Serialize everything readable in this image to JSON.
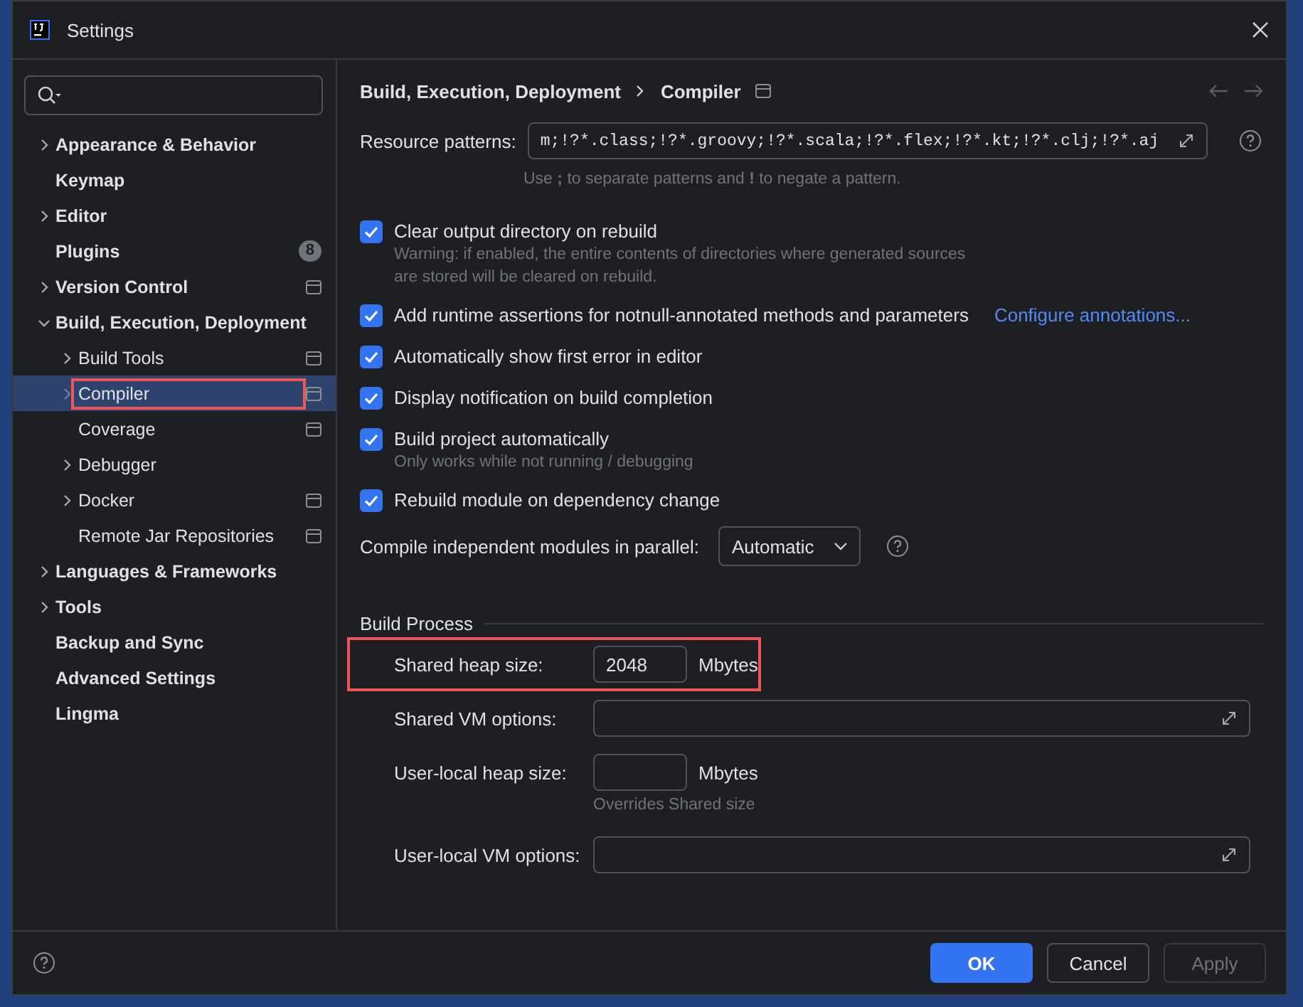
{
  "window": {
    "title": "Settings"
  },
  "sidebar": {
    "items": [
      {
        "label": "Appearance & Behavior",
        "has_children": true,
        "expanded": false,
        "selected": false
      },
      {
        "label": "Keymap",
        "has_children": false,
        "selected": false
      },
      {
        "label": "Editor",
        "has_children": true,
        "expanded": false,
        "selected": false
      },
      {
        "label": "Plugins",
        "has_children": false,
        "selected": false,
        "badge": "8"
      },
      {
        "label": "Version Control",
        "has_children": true,
        "expanded": false,
        "selected": false,
        "project_scope": true
      },
      {
        "label": "Build, Execution, Deployment",
        "has_children": true,
        "expanded": true,
        "selected": false,
        "children": [
          {
            "label": "Build Tools",
            "has_children": true,
            "expanded": false,
            "selected": false,
            "project_scope": true
          },
          {
            "label": "Compiler",
            "has_children": true,
            "expanded": false,
            "selected": true,
            "highlighted": true,
            "project_scope": true
          },
          {
            "label": "Coverage",
            "has_children": false,
            "selected": false,
            "project_scope": true
          },
          {
            "label": "Debugger",
            "has_children": true,
            "expanded": false,
            "selected": false
          },
          {
            "label": "Docker",
            "has_children": true,
            "expanded": false,
            "selected": false,
            "project_scope": true
          },
          {
            "label": "Remote Jar Repositories",
            "has_children": false,
            "selected": false,
            "project_scope": true
          }
        ]
      },
      {
        "label": "Languages & Frameworks",
        "has_children": true,
        "expanded": false,
        "selected": false
      },
      {
        "label": "Tools",
        "has_children": true,
        "expanded": false,
        "selected": false
      },
      {
        "label": "Backup and Sync",
        "has_children": false,
        "selected": false
      },
      {
        "label": "Advanced Settings",
        "has_children": false,
        "selected": false
      },
      {
        "label": "Lingma",
        "has_children": false,
        "selected": false
      }
    ]
  },
  "breadcrumb": [
    "Build, Execution, Deployment",
    "Compiler"
  ],
  "resource_patterns": {
    "label": "Resource patterns:",
    "value": "m;!?*.class;!?*.groovy;!?*.scala;!?*.flex;!?*.kt;!?*.clj;!?*.aj",
    "hint": "Use **;** to separate patterns and **!** to negate a pattern."
  },
  "options": [
    {
      "label": "Clear output directory on rebuild",
      "checked": true,
      "note": "Warning: if enabled, the entire contents of directories where generated sources are stored will be cleared on rebuild."
    },
    {
      "label": "Add runtime assertions for notnull-annotated methods and parameters",
      "checked": true,
      "link": "Configure annotations..."
    },
    {
      "label": "Automatically show first error in editor",
      "checked": true
    },
    {
      "label": "Display notification on build completion",
      "checked": true
    },
    {
      "label": "Build project automatically",
      "checked": true,
      "note": "Only works while not running / debugging"
    },
    {
      "label": "Rebuild module on dependency change",
      "checked": true
    }
  ],
  "parallel": {
    "label": "Compile independent modules in parallel:",
    "value": "Automatic"
  },
  "build_process": {
    "title": "Build Process",
    "fields": [
      {
        "kind": "number",
        "label": "Shared heap size:",
        "value": "2048",
        "unit": "Mbytes",
        "highlighted": true
      },
      {
        "kind": "text",
        "label": "Shared VM options:"
      },
      {
        "kind": "number",
        "label": "User-local heap size:",
        "unit": "Mbytes",
        "note": "Overrides Shared size"
      },
      {
        "kind": "text",
        "label": "User-local VM options:"
      }
    ]
  },
  "buttons": [
    {
      "label": "OK",
      "kind": "primary",
      "disabled": false
    },
    {
      "label": "Cancel",
      "kind": "normal",
      "disabled": false
    },
    {
      "label": "Apply",
      "kind": "normal",
      "disabled": true
    }
  ]
}
